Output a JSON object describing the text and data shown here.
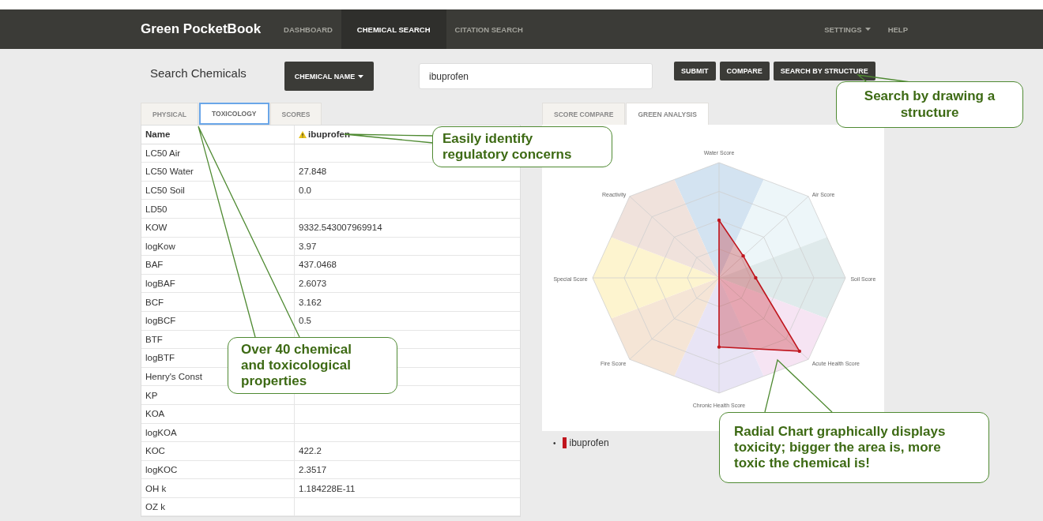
{
  "nav": {
    "brand": "Green PocketBook",
    "items": [
      {
        "label": "DASHBOARD",
        "selected": false
      },
      {
        "label": "CHEMICAL SEARCH",
        "selected": true
      },
      {
        "label": "CITATION SEARCH",
        "selected": false
      }
    ],
    "right": [
      {
        "label": "SETTINGS",
        "dropdown": true
      },
      {
        "label": "HELP",
        "dropdown": false
      }
    ]
  },
  "search": {
    "title": "Search Chemicals",
    "mode_button": "CHEMICAL NAME",
    "value": "ibuprofen",
    "buttons": [
      "SUBMIT",
      "COMPARE",
      "SEARCH BY STRUCTURE"
    ]
  },
  "left_tabs": [
    {
      "label": "PHYSICAL",
      "selected": false
    },
    {
      "label": "TOXICOLOGY",
      "selected": true
    },
    {
      "label": "SCORES",
      "selected": false
    }
  ],
  "table": {
    "columns": [
      "Name",
      "ibuprofen"
    ],
    "header_warning": true,
    "rows": [
      {
        "name": "LC50 Air"
      },
      {
        "name": "LC50 Water",
        "value": "27.848"
      },
      {
        "name": "LC50 Soil",
        "value": "0.0"
      },
      {
        "name": "LD50"
      },
      {
        "name": "KOW",
        "value": "9332.543007969914"
      },
      {
        "name": "logKow",
        "value": "3.97"
      },
      {
        "name": "BAF",
        "value": "437.0468"
      },
      {
        "name": "logBAF",
        "value": "2.6073"
      },
      {
        "name": "BCF",
        "value": "3.162"
      },
      {
        "name": "logBCF",
        "value": "0.5"
      },
      {
        "name": "BTF"
      },
      {
        "name": "logBTF"
      },
      {
        "name": "Henry's Const"
      },
      {
        "name": "KP"
      },
      {
        "name": "KOA"
      },
      {
        "name": "logKOA"
      },
      {
        "name": "KOC",
        "value": "422.2"
      },
      {
        "name": "logKOC",
        "value": "2.3517"
      },
      {
        "name": "OH k",
        "value": "1.184228E-11"
      },
      {
        "name": "OZ k"
      }
    ]
  },
  "right_tabs": [
    {
      "label": "SCORE COMPARE",
      "selected": false
    },
    {
      "label": "GREEN ANALYSIS",
      "selected": true
    }
  ],
  "radar": {
    "axes": [
      "Water Score",
      "Air Score",
      "Soil Score",
      "Acute Health Score",
      "Chronic Health Score",
      "Fire Score",
      "Special Score",
      "Reactivity"
    ],
    "legend": [
      {
        "bullet": "•",
        "name": "ibuprofen",
        "color": "#c0161e"
      }
    ]
  },
  "callouts": [
    {
      "text": "Easily identify regulatory concerns"
    },
    {
      "text": "Search by drawing a structure"
    },
    {
      "text": "Over 40 chemical and toxicological properties"
    },
    {
      "text": "Radial Chart graphically displays toxicity; bigger the area is, more toxic the chemical is!"
    }
  ]
}
